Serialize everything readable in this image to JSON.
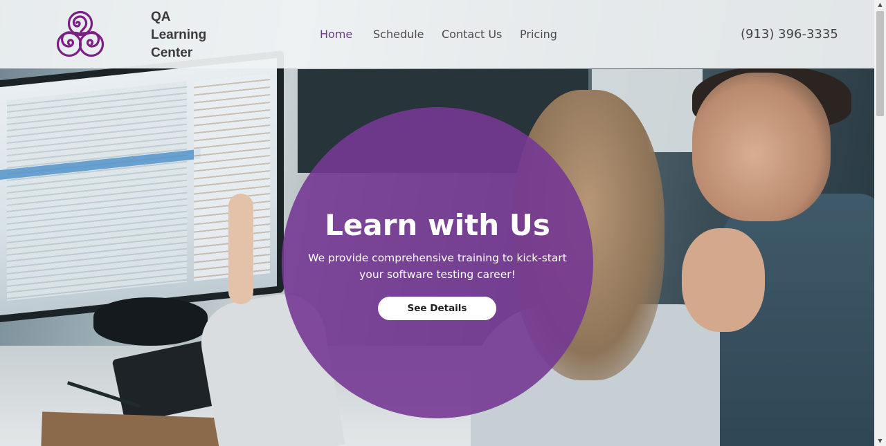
{
  "brand": {
    "line1": "QA",
    "line2": "Learning",
    "line3": "Center",
    "logo_icon": "triple-spiral-icon",
    "logo_color": "#7b1f86"
  },
  "nav": {
    "items": [
      {
        "label": "Home",
        "active": true
      },
      {
        "label": "Schedule",
        "active": false
      },
      {
        "label": "Contact Us",
        "active": false
      },
      {
        "label": "Pricing",
        "active": false
      }
    ],
    "active_color": "#6b3b86"
  },
  "phone": "(913) 396-3335",
  "hero": {
    "title": "Learn with Us",
    "subtitle": "We provide comprehensive training to kick-start your software testing career!",
    "cta_label": "See Details",
    "circle_color": "#763894"
  },
  "scrollbar": {
    "up_icon": "▲",
    "down_icon": "▼"
  }
}
